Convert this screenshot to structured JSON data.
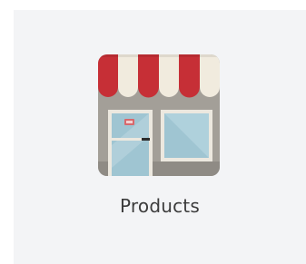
{
  "app_tile": {
    "label": "Products",
    "icon": "storefront-icon"
  },
  "colors": {
    "tile_background": "#f3f4f6",
    "awning_red": "#c62f36",
    "awning_cream": "#f1ebde",
    "wall": "#a39f98",
    "glass": "#9fc5d2",
    "label_text": "#3c3c3c"
  }
}
